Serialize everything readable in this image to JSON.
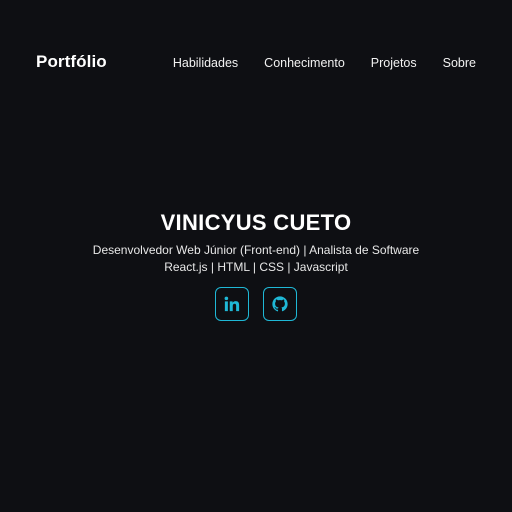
{
  "header": {
    "brand": "Portfólio",
    "nav": [
      {
        "label": "Habilidades"
      },
      {
        "label": "Conhecimento"
      },
      {
        "label": "Projetos"
      },
      {
        "label": "Sobre"
      }
    ]
  },
  "hero": {
    "name": "VINICYUS CUETO",
    "role": "Desenvolvedor Web Júnior (Front-end) | Analista de Software",
    "stack": "React.js | HTML | CSS | Javascript",
    "socials": [
      {
        "icon": "linkedin-icon"
      },
      {
        "icon": "github-icon"
      }
    ]
  },
  "colors": {
    "background": "#0e0f13",
    "accent": "#1fb8d6",
    "text": "#ffffff"
  }
}
